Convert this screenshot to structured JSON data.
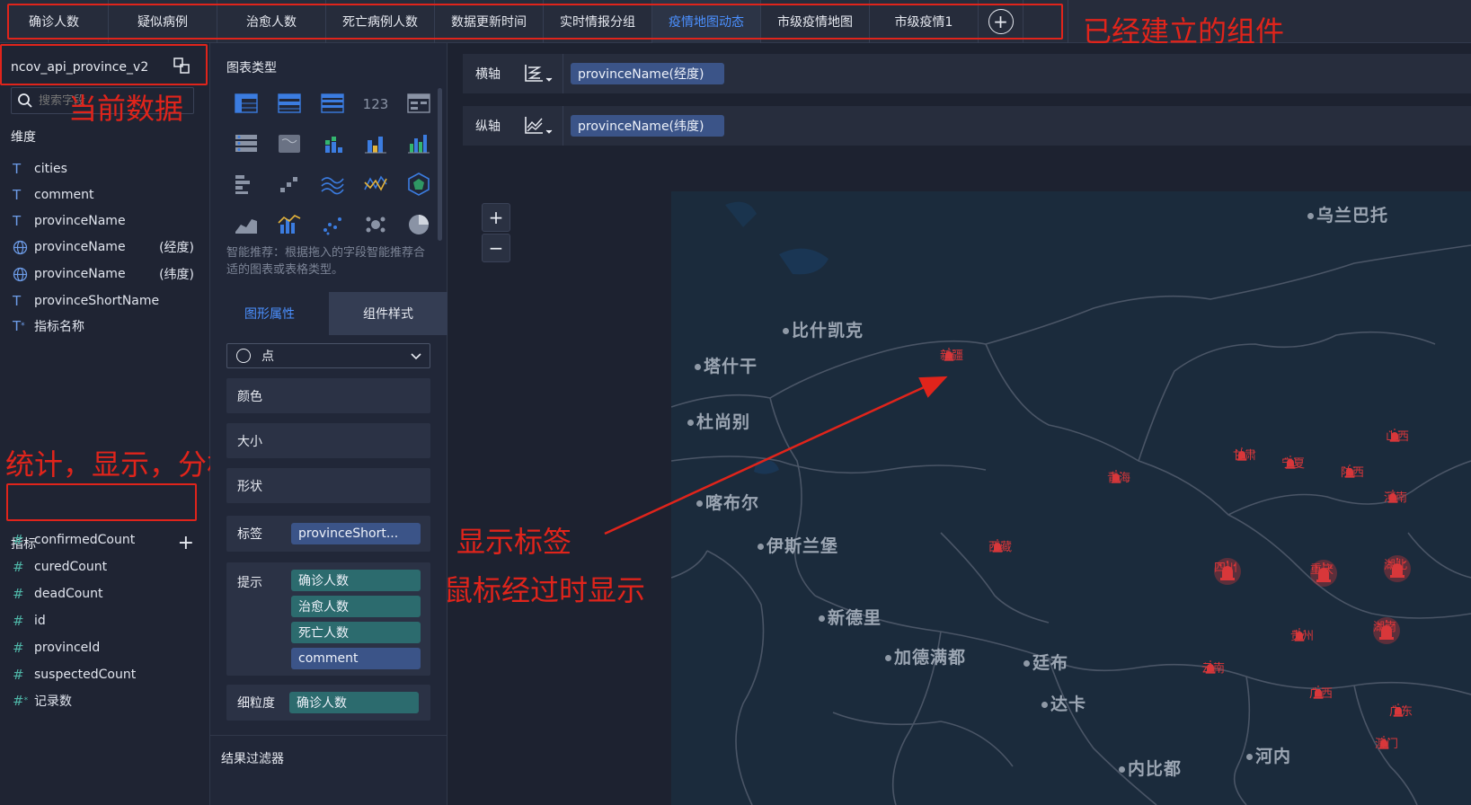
{
  "topbar": {
    "tabs": [
      {
        "label": "确诊人数",
        "active": false
      },
      {
        "label": "疑似病例",
        "active": false
      },
      {
        "label": "治愈人数",
        "active": false
      },
      {
        "label": "死亡病例人数",
        "active": false
      },
      {
        "label": "数据更新时间",
        "active": false
      },
      {
        "label": "实时情报分组",
        "active": false
      },
      {
        "label": "疫情地图动态",
        "active": true
      },
      {
        "label": "市级疫情地图",
        "active": false
      },
      {
        "label": "市级疫情1",
        "active": false
      }
    ],
    "add_icon": "plus-circle-icon"
  },
  "annotations": {
    "built_components": "已经建立的组件",
    "current_data": "当前数据",
    "stats": "统计，显示，分析",
    "show_label": "显示标签",
    "hover_show": "鼠标经过时显示",
    "color": "#e0241b"
  },
  "left": {
    "dataset_name": "ncov_api_province_v2",
    "dataset_icon": "switch-dataset-icon",
    "search_placeholder": "搜索字段",
    "dimension_title": "维度",
    "dimensions": [
      {
        "type": "T",
        "name": "cities",
        "sub": ""
      },
      {
        "type": "T",
        "name": "comment",
        "sub": ""
      },
      {
        "type": "T",
        "name": "provinceName",
        "sub": ""
      },
      {
        "type": "globe",
        "name": "provinceName",
        "sub": "(经度)"
      },
      {
        "type": "globe",
        "name": "provinceName",
        "sub": "(纬度)"
      },
      {
        "type": "T",
        "name": "provinceShortName",
        "sub": ""
      },
      {
        "type": "T*",
        "name": "指标名称",
        "sub": ""
      }
    ],
    "metric_title": "指标",
    "metrics": [
      {
        "type": "#",
        "name": "confirmedCount"
      },
      {
        "type": "#",
        "name": "curedCount"
      },
      {
        "type": "#",
        "name": "deadCount"
      },
      {
        "type": "#",
        "name": "id"
      },
      {
        "type": "#",
        "name": "provinceId"
      },
      {
        "type": "#",
        "name": "suspectedCount"
      },
      {
        "type": "#*",
        "name": "记录数"
      }
    ]
  },
  "middle": {
    "chart_types_title": "图表类型",
    "recommend_text": "智能推荐：根据拖入的字段智能推荐合适的图表或表格类型。",
    "tab_graph": "图形属性",
    "tab_style": "组件样式",
    "shape_select": "点",
    "color_label": "颜色",
    "size_label": "大小",
    "shape_label": "形状",
    "label_label": "标签",
    "label_pill": "provinceShort...",
    "tips_label": "提示",
    "tips_pills": [
      "确诊人数",
      "治愈人数",
      "死亡人数",
      "comment"
    ],
    "granularity_label": "细粒度",
    "granularity_pill": "确诊人数",
    "result_filter": "结果过滤器"
  },
  "right": {
    "x_axis_label": "横轴",
    "x_axis_field": "provinceName(经度)",
    "y_axis_label": "纵轴",
    "y_axis_field": "provinceName(纬度)",
    "zoom_in": "+",
    "zoom_out": "−"
  },
  "map": {
    "background": "#1b2b3c",
    "places": [
      "乌兰巴托",
      "比什凯克",
      "塔什干",
      "杜尚别",
      "喀布尔",
      "伊斯兰堡",
      "新德里",
      "加德满都",
      "廷布",
      "达卡",
      "河内",
      "内比都"
    ],
    "provinces": [
      "新疆",
      "甘肃",
      "宁夏",
      "山西",
      "陕西",
      "青海",
      "河南",
      "西藏",
      "四川",
      "重庆",
      "湖北",
      "贵州",
      "湖南",
      "云南",
      "广西",
      "澳门",
      "广东"
    ],
    "marker_color": "#d8373a"
  }
}
